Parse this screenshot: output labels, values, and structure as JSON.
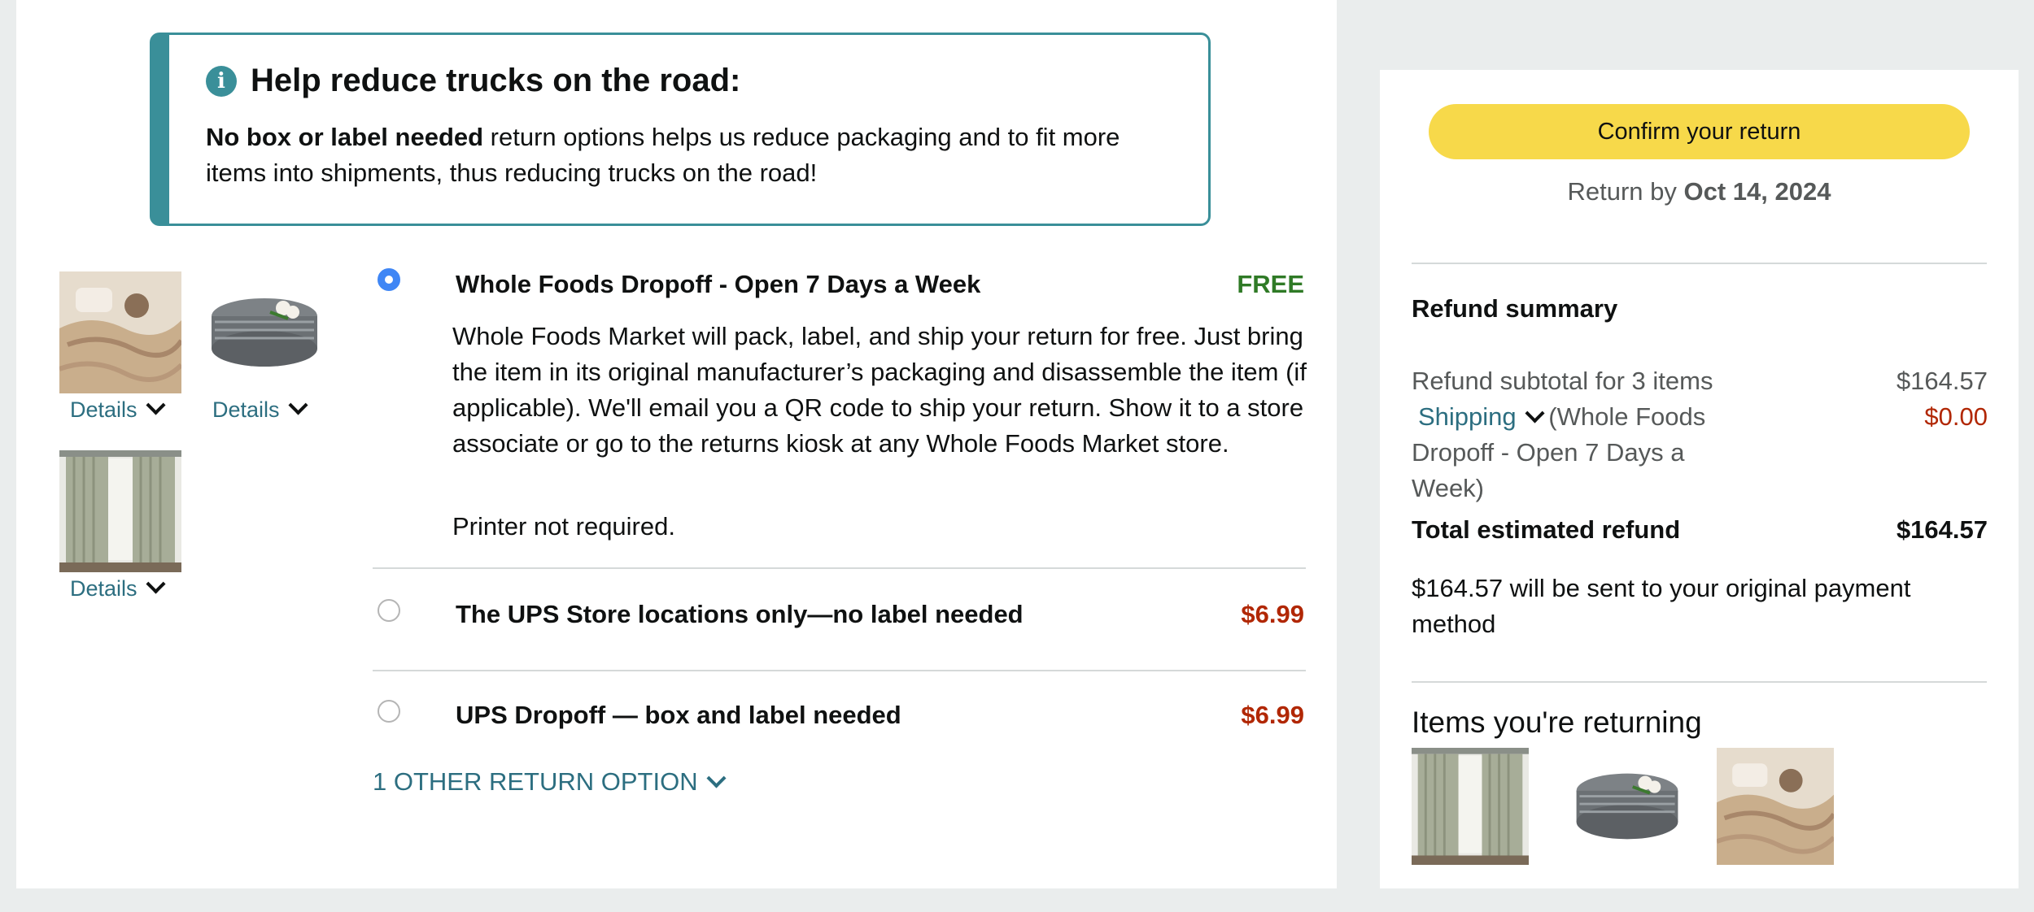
{
  "info": {
    "title": "Help reduce trucks on the road:",
    "bold_lead": "No box or label needed",
    "text": " return options helps us reduce packaging and to fit more items into shipments, thus reducing trucks on the road!"
  },
  "thumbnails": {
    "details_label": "Details"
  },
  "options": [
    {
      "title": "Whole Foods Dropoff - Open 7 Days a Week",
      "price": "FREE",
      "selected": true,
      "description": "Whole Foods Market will pack, label, and ship your return for free. Just bring the item in its original manufacturer’s packaging and disassemble the item (if applicable). We'll email you a QR code to ship your return. Show it to a store associate or go to the returns kiosk at any Whole Foods Market store.",
      "note": "Printer not required."
    },
    {
      "title": "The UPS Store locations only—no label needed",
      "price": "$6.99",
      "selected": false
    },
    {
      "title": "UPS Dropoff — box and label needed",
      "price": "$6.99",
      "selected": false
    }
  ],
  "other_options_label": "1 OTHER RETURN OPTION",
  "summary": {
    "confirm_label": "Confirm your return",
    "return_by_prefix": "Return by ",
    "return_by_date": "Oct 14, 2024",
    "refund_title": "Refund summary",
    "subtotal_label": "Refund subtotal for 3 items",
    "subtotal_value": "$164.57",
    "shipping_link": "Shipping",
    "shipping_detail": " (Whole Foods Dropoff - Open 7 Days a Week)",
    "shipping_value": "$0.00",
    "total_label": "Total estimated refund",
    "total_value": "$164.57",
    "sent_text": "$164.57 will be sent to your original payment method",
    "items_title": "Items you're returning"
  },
  "colors": {
    "accent_teal": "#3a8f99",
    "link": "#2c6e80",
    "free": "#2f7a26",
    "price": "#b12704",
    "confirm_button": "#f7d94a",
    "radio_selected": "#3f86f5"
  }
}
